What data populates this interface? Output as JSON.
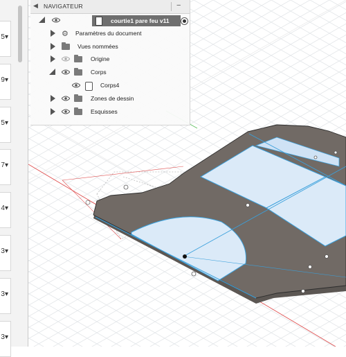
{
  "navigator": {
    "title": "NAVIGATEUR",
    "document_name": "courtie1 pare feu v11",
    "items": [
      {
        "label": "Paramètres du document"
      },
      {
        "label": "Vues nommées"
      },
      {
        "label": "Origine"
      },
      {
        "label": "Corps"
      },
      {
        "label": "Corps4"
      },
      {
        "label": "Zones de dessin"
      },
      {
        "label": "Esquisses"
      }
    ]
  },
  "version_list": [
    "5",
    "9",
    "5",
    "7",
    "4",
    "3",
    "3",
    "3"
  ],
  "colors": {
    "body_fill": "#716a65",
    "body_edge": "#2c2c2c",
    "sketch_region": "#dbeaf8",
    "sketch_line": "#3aa0dc",
    "grid": "#e2e6ea",
    "axis_red": "#e05050",
    "axis_green": "#5fbf5f"
  }
}
